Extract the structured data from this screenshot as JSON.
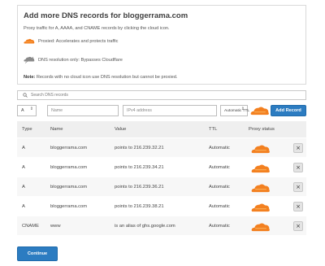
{
  "info": {
    "title": "Add more DNS records for bloggerrama.com",
    "subtitle": "Proxy traffic for A, AAAA, and CNAME records by clicking the cloud icon.",
    "legend_proxied": "Proxied: Accelerates and protects traffic",
    "legend_dns_only": "DNS resolution only: Bypasses Cloudflare",
    "note_label": "Note:",
    "note_text": " Records with no cloud icon use DNS resolution but cannot be proxied."
  },
  "search": {
    "placeholder": "Search DNS records"
  },
  "add_record": {
    "type_value": "A",
    "name_placeholder": "Name",
    "address_placeholder": "IPv4 address",
    "ttl_value": "Automatic TTL",
    "button_label": "Add Record"
  },
  "table": {
    "headers": {
      "type": "Type",
      "name": "Name",
      "value": "Value",
      "ttl": "TTL",
      "proxy": "Proxy status"
    },
    "rows": [
      {
        "type": "A",
        "name": "bloggerrama.com",
        "value": "points to 216.239.32.21",
        "ttl": "Automatic",
        "delete": "×"
      },
      {
        "type": "A",
        "name": "bloggerrama.com",
        "value": "points to 216.239.34.21",
        "ttl": "Automatic",
        "delete": "×"
      },
      {
        "type": "A",
        "name": "bloggerrama.com",
        "value": "points to 216.239.36.21",
        "ttl": "Automatic",
        "delete": "×"
      },
      {
        "type": "A",
        "name": "bloggerrama.com",
        "value": "points to 216.239.38.21",
        "ttl": "Automatic",
        "delete": "×"
      },
      {
        "type": "CNAME",
        "name": "www",
        "value": "is an alias of ghs.google.com",
        "ttl": "Automatic",
        "delete": "×"
      }
    ]
  },
  "continue_label": "Continue",
  "colors": {
    "accent": "#2c7cc1",
    "cloud_orange": "#f38020",
    "cloud_gray": "#8a8a8a"
  },
  "icons": {
    "proxied": "orange-cloud-icon",
    "dns_only": "gray-cloud-icon",
    "search": "search-icon",
    "delete": "close-icon"
  }
}
